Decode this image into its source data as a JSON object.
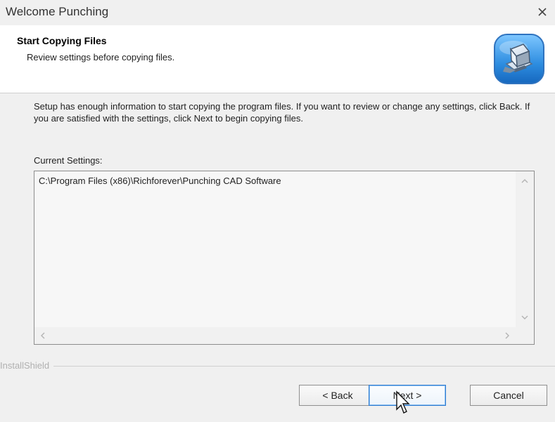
{
  "window": {
    "title": "Welcome Punching"
  },
  "header": {
    "title": "Start Copying Files",
    "subtitle": "Review settings before copying files."
  },
  "main": {
    "description": "Setup has enough information to start copying the program files.  If you want to review or change any settings, click Back.  If you are satisfied with the settings, click Next to begin copying files.",
    "settings_label": "Current Settings:",
    "settings_value": "C:\\Program Files (x86)\\Richforever\\Punching CAD Software"
  },
  "footer": {
    "brand_text": "InstallShield",
    "back_label": "< Back",
    "next_label": "Next >",
    "cancel_label": "Cancel"
  },
  "icons": {
    "close": "close-icon",
    "installer": "computer-installer-icon",
    "scroll_up": "chevron-up-icon",
    "scroll_down": "chevron-down-icon",
    "scroll_left": "chevron-left-icon",
    "scroll_right": "chevron-right-icon",
    "cursor": "mouse-pointer-icon"
  },
  "colors": {
    "accent": "#2e7bd1",
    "background": "#f0f0f0",
    "panel": "#ffffff"
  }
}
